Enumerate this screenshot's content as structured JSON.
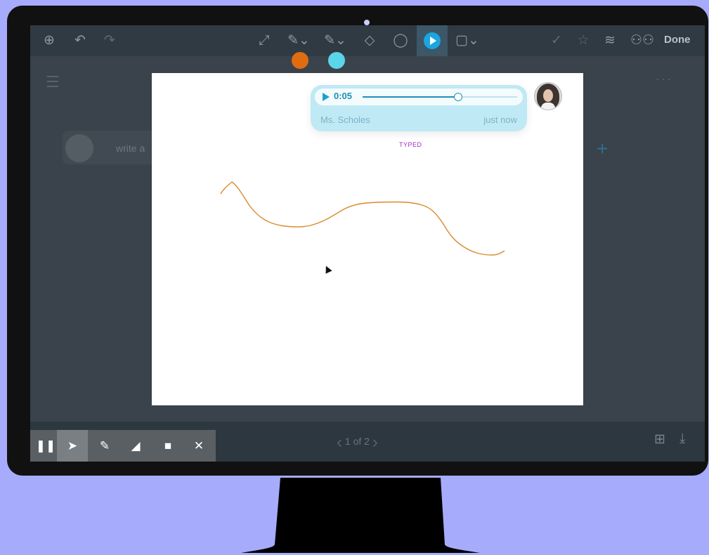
{
  "toolbar": {
    "done_label": "Done",
    "icons": [
      "zoom-in-icon",
      "undo-icon",
      "redo-icon",
      "fullscreen-icon",
      "pen-icon",
      "highlighter-icon",
      "eraser-icon",
      "comment-icon",
      "play-feedback-icon",
      "text-tool-icon",
      "check-icon",
      "star-icon",
      "layers-icon",
      "group-icon"
    ]
  },
  "sidebar": {
    "comment_preview": "write a"
  },
  "feedback": {
    "time": "0:05",
    "progress": 0.62,
    "author": "Ms. Scholes",
    "when": "just now",
    "typed_label": "TYPED"
  },
  "pager": {
    "label": "1 of 2"
  },
  "colors": {
    "accent": "#1aa6de",
    "pen_orange": "#e06c12",
    "pen_cyan": "#5bd5e9",
    "stroke": "#d98a2b",
    "typed": "#9b2cc4"
  }
}
